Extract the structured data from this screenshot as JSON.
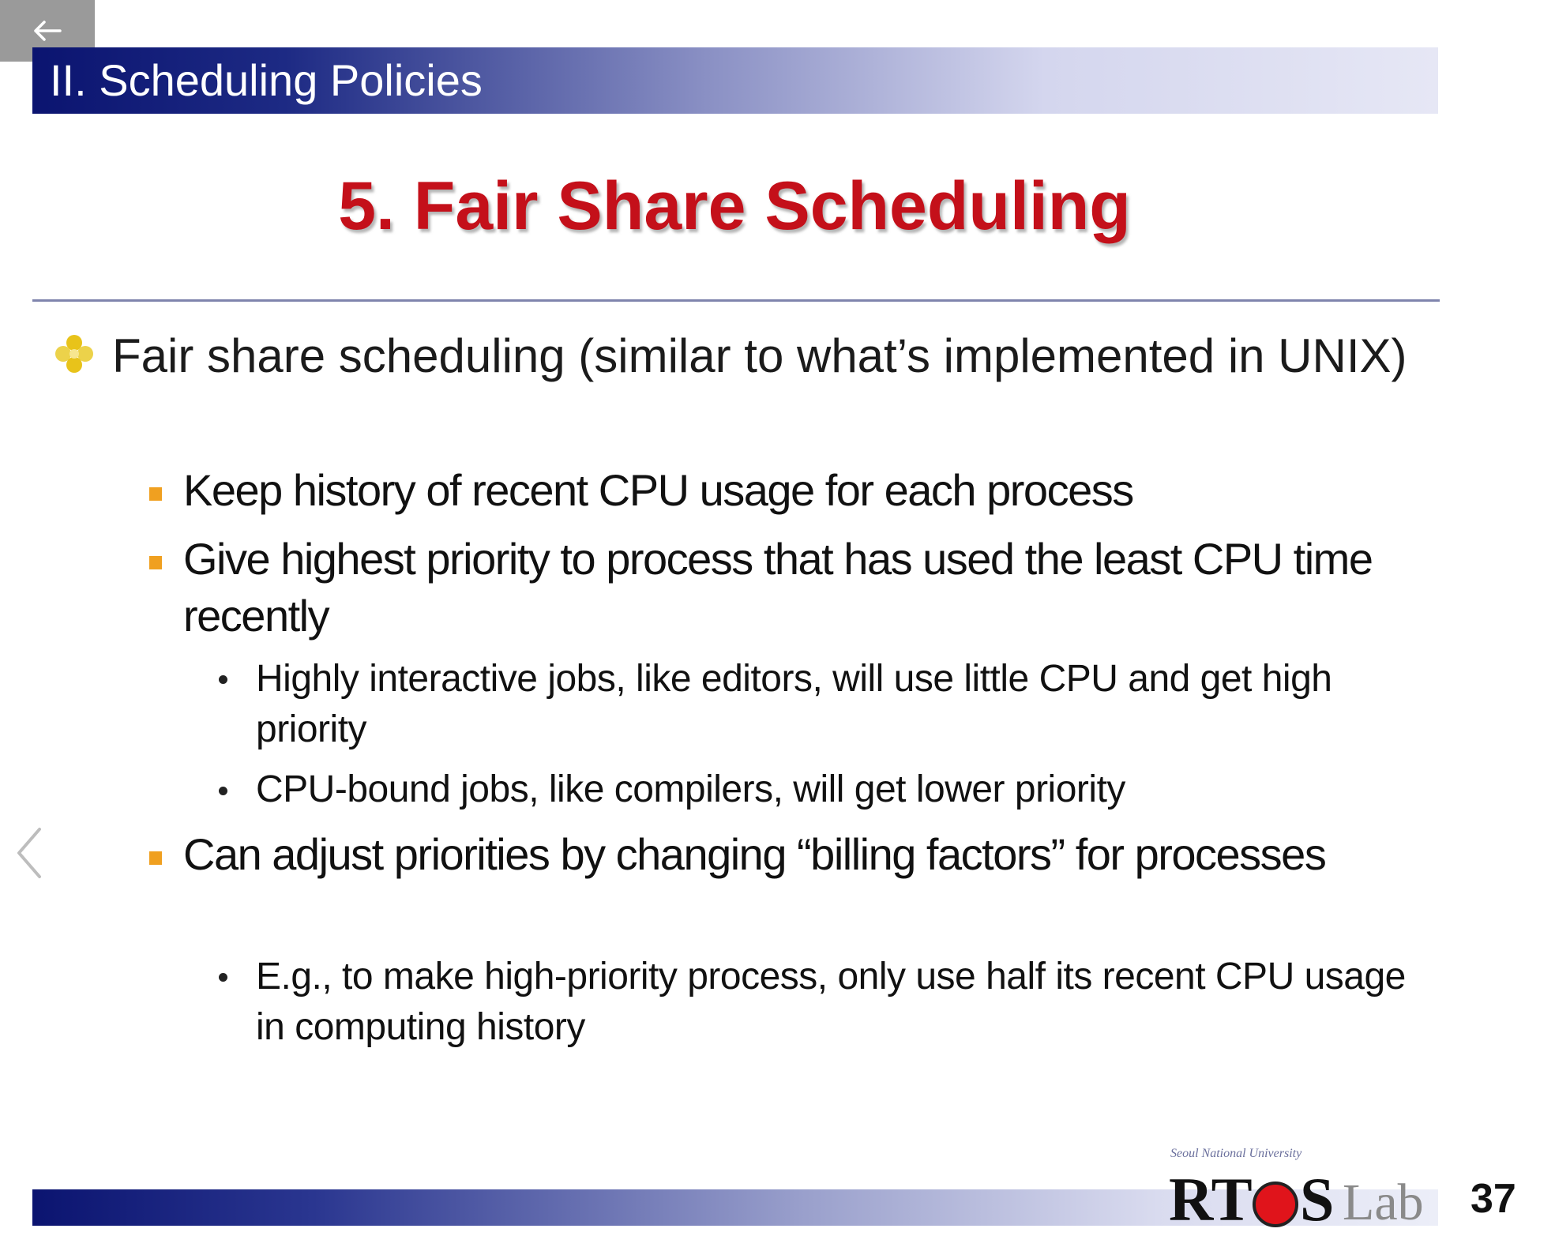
{
  "nav": {
    "back_icon": "arrow-left-icon",
    "prev_icon": "chevron-left-icon"
  },
  "slide": {
    "section_title": "II. Scheduling Policies",
    "title": "5. Fair Share Scheduling",
    "bullet_l1": "Fair share scheduling (similar to what’s implemented in UNIX)",
    "sub1": "Keep history of recent CPU usage for each process",
    "sub2": "Give highest priority to process that has used the least CPU time recently",
    "sub2_a": "Highly interactive jobs, like editors, will use little CPU and get high priority",
    "sub2_b": "CPU-bound jobs, like compilers, will get lower priority",
    "sub3": "Can adjust priorities by changing “billing factors” for processes",
    "sub3_a": "E.g., to make high-priority process, only use half its recent CPU usage in computing history",
    "page_number": "37"
  },
  "logo": {
    "university": "Seoul National University",
    "name_rt": "RT",
    "name_s": "S",
    "name_lab": "Lab"
  },
  "colors": {
    "title_red": "#c4101a",
    "band_dark": "#0b1470",
    "bullet_orange": "#f0a020",
    "diamond_bullet": "#e8c31a"
  }
}
